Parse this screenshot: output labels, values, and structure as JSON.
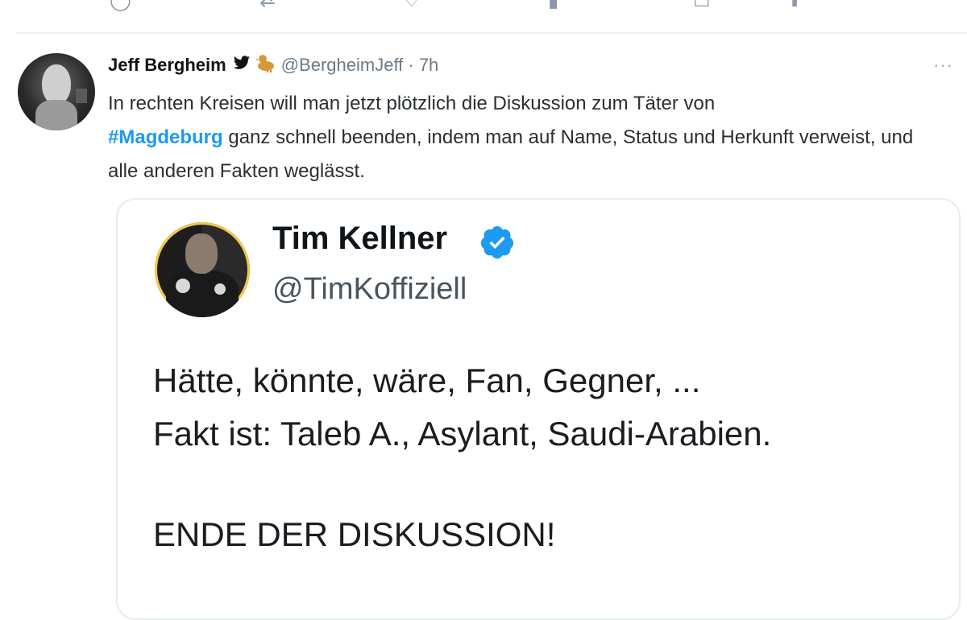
{
  "previous_tweet_actions": [
    {
      "icon": "reply-icon"
    },
    {
      "icon": "retweet-icon"
    },
    {
      "icon": "like-icon"
    },
    {
      "icon": "views-icon"
    },
    {
      "icon": "bookmark-icon"
    },
    {
      "icon": "share-icon"
    }
  ],
  "tweet": {
    "author_name": "Jeff Bergheim",
    "handle_time": "@BergheimJeff · 7h",
    "more": "···",
    "text_part1": "In rechten Kreisen will man jetzt plötzlich die Diskussion zum Täter von",
    "hashtag": "#Magdeburg",
    "text_part2": " ganz schnell beenden, indem man auf Name, Status und Herkunft verweist, und alle anderen Fakten weglässt."
  },
  "quoted_tweet": {
    "author_name": "Tim Kellner",
    "handle": "@TimKoffiziell",
    "line1": "Hätte, könnte, wäre, Fan, Gegner, ...",
    "line2": "Fakt ist: Taleb A., Asylant, Saudi-Arabien.",
    "line3": "ENDE DER DISKUSSION!"
  },
  "colors": {
    "hashtag": "#1d9bf0",
    "verified": "#1d9bf0",
    "handle": "#6d7a85"
  }
}
